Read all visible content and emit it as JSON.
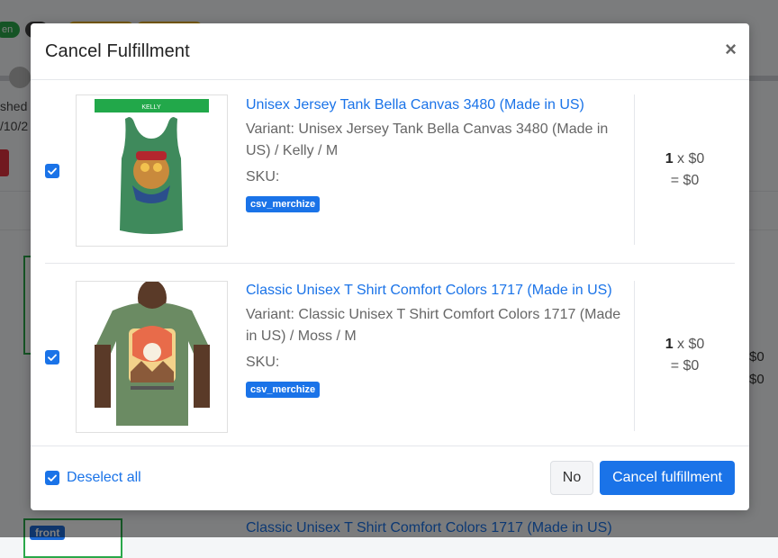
{
  "background": {
    "status_pill": "en",
    "line1": "shed o",
    "line2": "/10/2",
    "front_badge": "front",
    "product_title": "Classic Unisex T Shirt Comfort Colors 1717 (Made in US)",
    "amount1": "$0",
    "amount2": "$0"
  },
  "modal": {
    "title": "Cancel Fulfillment",
    "close_glyph": "×",
    "items": [
      {
        "checked": true,
        "image_banner": "KELLY",
        "title": "Unisex Jersey Tank Bella Canvas 3480 (Made in US)",
        "variant": "Variant: Unisex Jersey Tank Bella Canvas 3480 (Made in US) / Kelly / M",
        "sku": "SKU:",
        "tag": "csv_merchize",
        "qty": "1",
        "qty_price": "x $0",
        "total": "= $0"
      },
      {
        "checked": true,
        "image_banner": "",
        "title": "Classic Unisex T Shirt Comfort Colors 1717 (Made in US)",
        "variant": "Variant: Classic Unisex T Shirt Comfort Colors 1717 (Made in US) / Moss / M",
        "sku": "SKU:",
        "tag": "csv_merchize",
        "qty": "1",
        "qty_price": "x $0",
        "total": "= $0"
      }
    ],
    "footer": {
      "deselect_label": "Deselect all",
      "no_label": "No",
      "cancel_label": "Cancel fulfillment"
    }
  },
  "colors": {
    "accent": "#1a73e8",
    "tag_bg": "#1a73e8",
    "tank_green": "#3f8a5c",
    "tee_moss": "#6b8b63"
  }
}
